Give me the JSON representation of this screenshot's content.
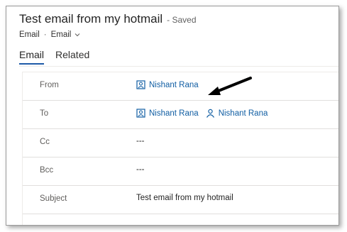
{
  "header": {
    "title": "Test email from my hotmail",
    "status": "- Saved",
    "entity": "Email",
    "separator": "·",
    "form_selector": "Email"
  },
  "tabs": [
    {
      "label": "Email",
      "active": true
    },
    {
      "label": "Related",
      "active": false
    }
  ],
  "fields": {
    "from": {
      "label": "From",
      "values": [
        {
          "name": "Nishant Rana",
          "icon": "contact-icon"
        }
      ]
    },
    "to": {
      "label": "To",
      "values": [
        {
          "name": "Nishant Rana",
          "icon": "contact-icon"
        },
        {
          "name": "Nishant Rana",
          "icon": "user-icon"
        }
      ]
    },
    "cc": {
      "label": "Cc",
      "value": "---"
    },
    "bcc": {
      "label": "Bcc",
      "value": "---"
    },
    "subject": {
      "label": "Subject",
      "value": "Test email from my hotmail"
    }
  },
  "colors": {
    "accent": "#1e5aa8",
    "link": "#115ea3",
    "annotation_arrow": "#000000"
  }
}
